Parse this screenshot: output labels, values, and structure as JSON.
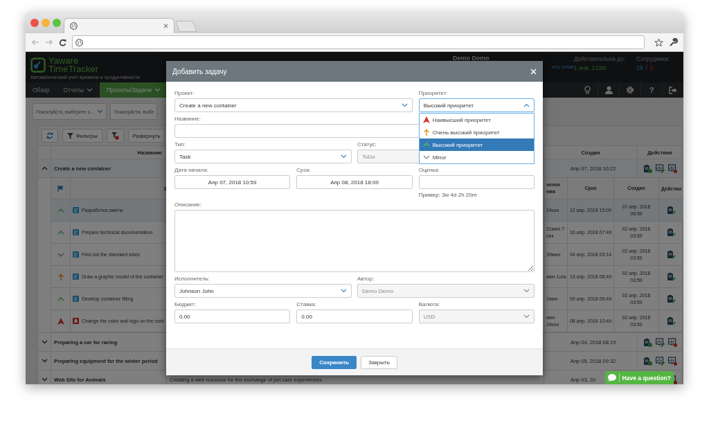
{
  "header": {
    "logo_line1": "Yaware",
    "logo_line2": "TimeTracker",
    "tagline": "Автоматический учет времени и продуктивности",
    "user": "Demo Demo",
    "plan_link": "ить план",
    "valid_label": "Действительна до:",
    "valid_value": "1 янв. 2108г",
    "employees_label": "Сотрудники:",
    "employees_active": "29",
    "employees_sep": "/",
    "employees_inactive": "0"
  },
  "nav": [
    {
      "label": "Обзор",
      "selected": false,
      "dropdown": false
    },
    {
      "label": "Отчеты",
      "selected": false,
      "dropdown": true
    },
    {
      "label": "Проекты/Задачи",
      "selected": true,
      "dropdown": true
    }
  ],
  "help_label": "?",
  "filters": [
    {
      "text": "Пожалуйста, выберите з...",
      "caret": true
    },
    {
      "text": "Пожалуйста, выбе",
      "caret": false
    }
  ],
  "toolbar": {
    "filters": "Фильтры",
    "expand": "Развернуть"
  },
  "table": {
    "columns": {
      "name": "Название",
      "created": "Создан",
      "actions": "Действия"
    },
    "subcolumns": {
      "title": "З",
      "spent": "ченое емя",
      "due": "Срок",
      "created": "Создан",
      "actions": "Действи"
    },
    "groups": [
      {
        "name": "Create a new container",
        "expanded": true,
        "created": "Апр 07, 2018 10:22",
        "actions": [
          {
            "kind": "add"
          },
          {
            "kind": "edit"
          },
          {
            "kind": "delete"
          }
        ],
        "tasks": [
          {
            "priority": {
              "kind": "high"
            },
            "type": {
              "kind": "task"
            },
            "name": "Разработка сметы",
            "spent": "24сек",
            "due": "12 апр. 2018 15:00",
            "created": "07 апр. 2018 06:59",
            "selected": true
          },
          {
            "priority": {
              "kind": "high"
            },
            "type": {
              "kind": "task"
            },
            "name": "Prepare technical documentation",
            "spent": "31мин 7 сек",
            "due": "16 апр. 2018 07:49",
            "created": "02 апр. 2018 03:59",
            "selected": false
          },
          {
            "priority": {
              "kind": "minor"
            },
            "type": {
              "kind": "task"
            },
            "name": "Find out the standard sizes",
            "spent": "39мин",
            "due": "04 апр. 2018 03:14",
            "created": "02 апр. 2018 03:59",
            "selected": false
          },
          {
            "priority": {
              "kind": "very_high"
            },
            "type": {
              "kind": "task"
            },
            "name": "Draw a graphic model of the container",
            "spent": "мин 1сек",
            "due": "13 апр. 2018 08:49",
            "created": "02 апр. 2018 03:59",
            "selected": false
          },
          {
            "priority": {
              "kind": "high"
            },
            "type": {
              "kind": "task"
            },
            "name": "Develop container filling",
            "spent": "2мин",
            "due": "09 апр. 2018 09:49",
            "created": "02 апр. 2018 03:59",
            "selected": false
          },
          {
            "priority": {
              "kind": "highest"
            },
            "type": {
              "kind": "bug"
            },
            "name": "Change the color and logo on the cont",
            "spent": "мин 34сек",
            "due": "08 апр. 2018 10:49",
            "created": "02 апр. 2018 03:59",
            "selected": false
          }
        ]
      },
      {
        "name": "Preparing a car for racing",
        "expanded": false,
        "created": "Апр 04, 2018 08:19",
        "actions": [
          {
            "kind": "add"
          },
          {
            "kind": "edit"
          },
          {
            "kind": "delete"
          }
        ]
      },
      {
        "name": "Preparing equipment for the winter period",
        "expanded": false,
        "created": "Апр 05, 2018 09:32",
        "actions": [
          {
            "kind": "add"
          },
          {
            "kind": "edit"
          },
          {
            "kind": "delete"
          }
        ]
      },
      {
        "name": "Web Site for Animals",
        "expanded": false,
        "description": "Creating a web resource for the exchange of pet care experiences",
        "created": "Апр 03, 20",
        "actions": [
          {
            "kind": "delete"
          }
        ]
      }
    ]
  },
  "modal": {
    "title": "Добавить задачу",
    "project": {
      "label": "Проект:",
      "value": "Create a new container"
    },
    "priority": {
      "label": "Приоритет:",
      "value": "Высокий приоритет",
      "open": true,
      "options": [
        {
          "label": "Наивысший приоритет",
          "kind": "highest",
          "selected": false
        },
        {
          "label": "Очень высокий приоритет",
          "kind": "very_high",
          "selected": false
        },
        {
          "label": "Высокий приоритет",
          "kind": "high",
          "selected": true
        },
        {
          "label": "Minor",
          "kind": "minor",
          "selected": false
        }
      ]
    },
    "name": {
      "label": "Название:"
    },
    "type": {
      "label": "Тип:",
      "value": "Task"
    },
    "status": {
      "label": "Статус:",
      "value": "ToDo",
      "disabled": true
    },
    "start": {
      "label": "Дата начала:",
      "value": "Апр 07, 2018 10:59"
    },
    "due": {
      "label": "Срок:",
      "value": "Апр 08, 2018 18:00"
    },
    "estimate": {
      "label": "Оценка:",
      "hint": "Пример: 3w 4d 2h 20m"
    },
    "description": {
      "label": "Описание:"
    },
    "assignee": {
      "label": "Исполнитель:",
      "value": "Johnson John",
      "disabled": false
    },
    "author": {
      "label": "Автор:",
      "value": "Demo Demo",
      "disabled": true
    },
    "budget": {
      "label": "Бюджет:",
      "value": "0.00"
    },
    "rate": {
      "label": "Ставка:",
      "value": "0.00"
    },
    "currency": {
      "label": "Валюта:",
      "value": "USD",
      "disabled": true
    },
    "buttons": [
      {
        "label": "Сохранить",
        "kind": "primary"
      },
      {
        "label": "Закрыть",
        "kind": "default"
      }
    ]
  },
  "chat": {
    "label": "Have a question?"
  }
}
